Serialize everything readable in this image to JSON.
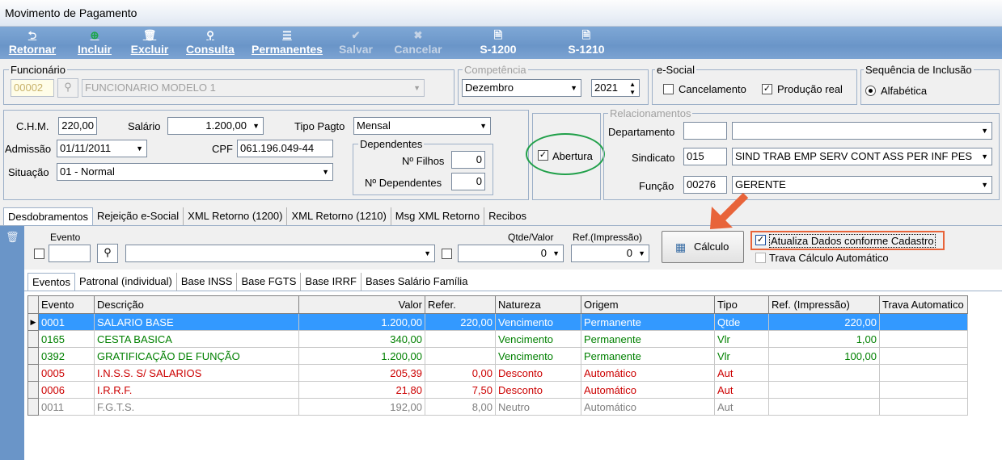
{
  "window": {
    "title": "Movimento de Pagamento"
  },
  "toolbar": {
    "retornar": "Retornar",
    "incluir": "Incluir",
    "excluir": "Excluir",
    "consulta": "Consulta",
    "permanentes": "Permanentes",
    "salvar": "Salvar",
    "cancelar": "Cancelar",
    "s1200": "S-1200",
    "s1210": "S-1210"
  },
  "funcionario": {
    "legend": "Funcionário",
    "code": "00002",
    "name": "FUNCIONARIO MODELO 1"
  },
  "competencia": {
    "legend": "Competência",
    "month": "Dezembro",
    "year": "2021"
  },
  "esocial": {
    "legend": "e-Social",
    "cancelamento": "Cancelamento",
    "producao": "Produção real"
  },
  "sequencia": {
    "legend": "Sequência de Inclusão",
    "alfabetica": "Alfabética"
  },
  "dados": {
    "chm_label": "C.H.M.",
    "chm": "220,00",
    "salario_label": "Salário",
    "salario": "1.200,00",
    "tipo_pagto_label": "Tipo Pagto",
    "tipo_pagto": "Mensal",
    "admissao_label": "Admissão",
    "admissao": "01/11/2011",
    "cpf_label": "CPF",
    "cpf": "061.196.049-44",
    "situacao_label": "Situação",
    "situacao": "01 - Normal",
    "dependentes_legend": "Dependentes",
    "filhos_label": "Nº Filhos",
    "filhos": "0",
    "ndep_label": "Nº Dependentes",
    "ndep": "0",
    "abertura": "Abertura"
  },
  "relacionamentos": {
    "legend": "Relacionamentos",
    "departamento_label": "Departamento",
    "departamento_code": "",
    "departamento": "",
    "sindicato_label": "Sindicato",
    "sindicato_code": "015",
    "sindicato": "SIND TRAB EMP SERV CONT ASS PER INF PES",
    "funcao_label": "Função",
    "funcao_code": "00276",
    "funcao": "GERENTE"
  },
  "tabs": [
    "Desdobramentos",
    "Rejeição e-Social",
    "XML Retorno (1200)",
    "XML Retorno (1210)",
    "Msg XML Retorno",
    "Recibos"
  ],
  "evento_bar": {
    "evento_label": "Evento",
    "evento": "",
    "descricao": "",
    "qtde_label": "Qtde/Valor",
    "qtde": "0",
    "ref_label": "Ref.(Impressão)",
    "ref": "0",
    "calculo": "Cálculo",
    "atualiza": "Atualiza Dados conforme Cadastro",
    "trava": "Trava Cálculo Automático"
  },
  "subtabs": [
    "Eventos",
    "Patronal (individual)",
    "Base INSS",
    "Base FGTS",
    "Base IRRF",
    "Bases Salário Família"
  ],
  "grid": {
    "columns": [
      "Evento",
      "Descrição",
      "Valor",
      "Refer.",
      "Natureza",
      "Origem",
      "Tipo",
      "Ref. (Impressão)",
      "Trava Automatico"
    ],
    "rows": [
      {
        "evento": "0001",
        "descricao": "SALARIO BASE",
        "valor": "1.200,00",
        "refer": "220,00",
        "natureza": "Vencimento",
        "origem": "Permanente",
        "tipo": "Qtde",
        "ref": "220,00",
        "trava": "",
        "style": "sel"
      },
      {
        "evento": "0165",
        "descricao": "CESTA BASICA",
        "valor": "340,00",
        "refer": "",
        "natureza": "Vencimento",
        "origem": "Permanente",
        "tipo": "Vlr",
        "ref": "1,00",
        "trava": "",
        "style": "green"
      },
      {
        "evento": "0392",
        "descricao": "GRATIFICAÇÃO DE FUNÇÃO",
        "valor": "1.200,00",
        "refer": "",
        "natureza": "Vencimento",
        "origem": "Permanente",
        "tipo": "Vlr",
        "ref": "100,00",
        "trava": "",
        "style": "green"
      },
      {
        "evento": "0005",
        "descricao": "I.N.S.S. S/ SALARIOS",
        "valor": "205,39",
        "refer": "0,00",
        "natureza": "Desconto",
        "origem": "Automático",
        "tipo": "Aut",
        "ref": "",
        "trava": "",
        "style": "red"
      },
      {
        "evento": "0006",
        "descricao": "I.R.R.F.",
        "valor": "21,80",
        "refer": "7,50",
        "natureza": "Desconto",
        "origem": "Automático",
        "tipo": "Aut",
        "ref": "",
        "trava": "",
        "style": "red"
      },
      {
        "evento": "0011",
        "descricao": "F.G.T.S.",
        "valor": "192,00",
        "refer": "8,00",
        "natureza": "Neutro",
        "origem": "Automático",
        "tipo": "Aut",
        "ref": "",
        "trava": "",
        "style": "gray"
      }
    ]
  },
  "colors": {
    "toolbar": "#6a95c8",
    "selection": "#3399ff",
    "annotation_orange": "#e8643a",
    "annotation_green": "#21a04a"
  }
}
